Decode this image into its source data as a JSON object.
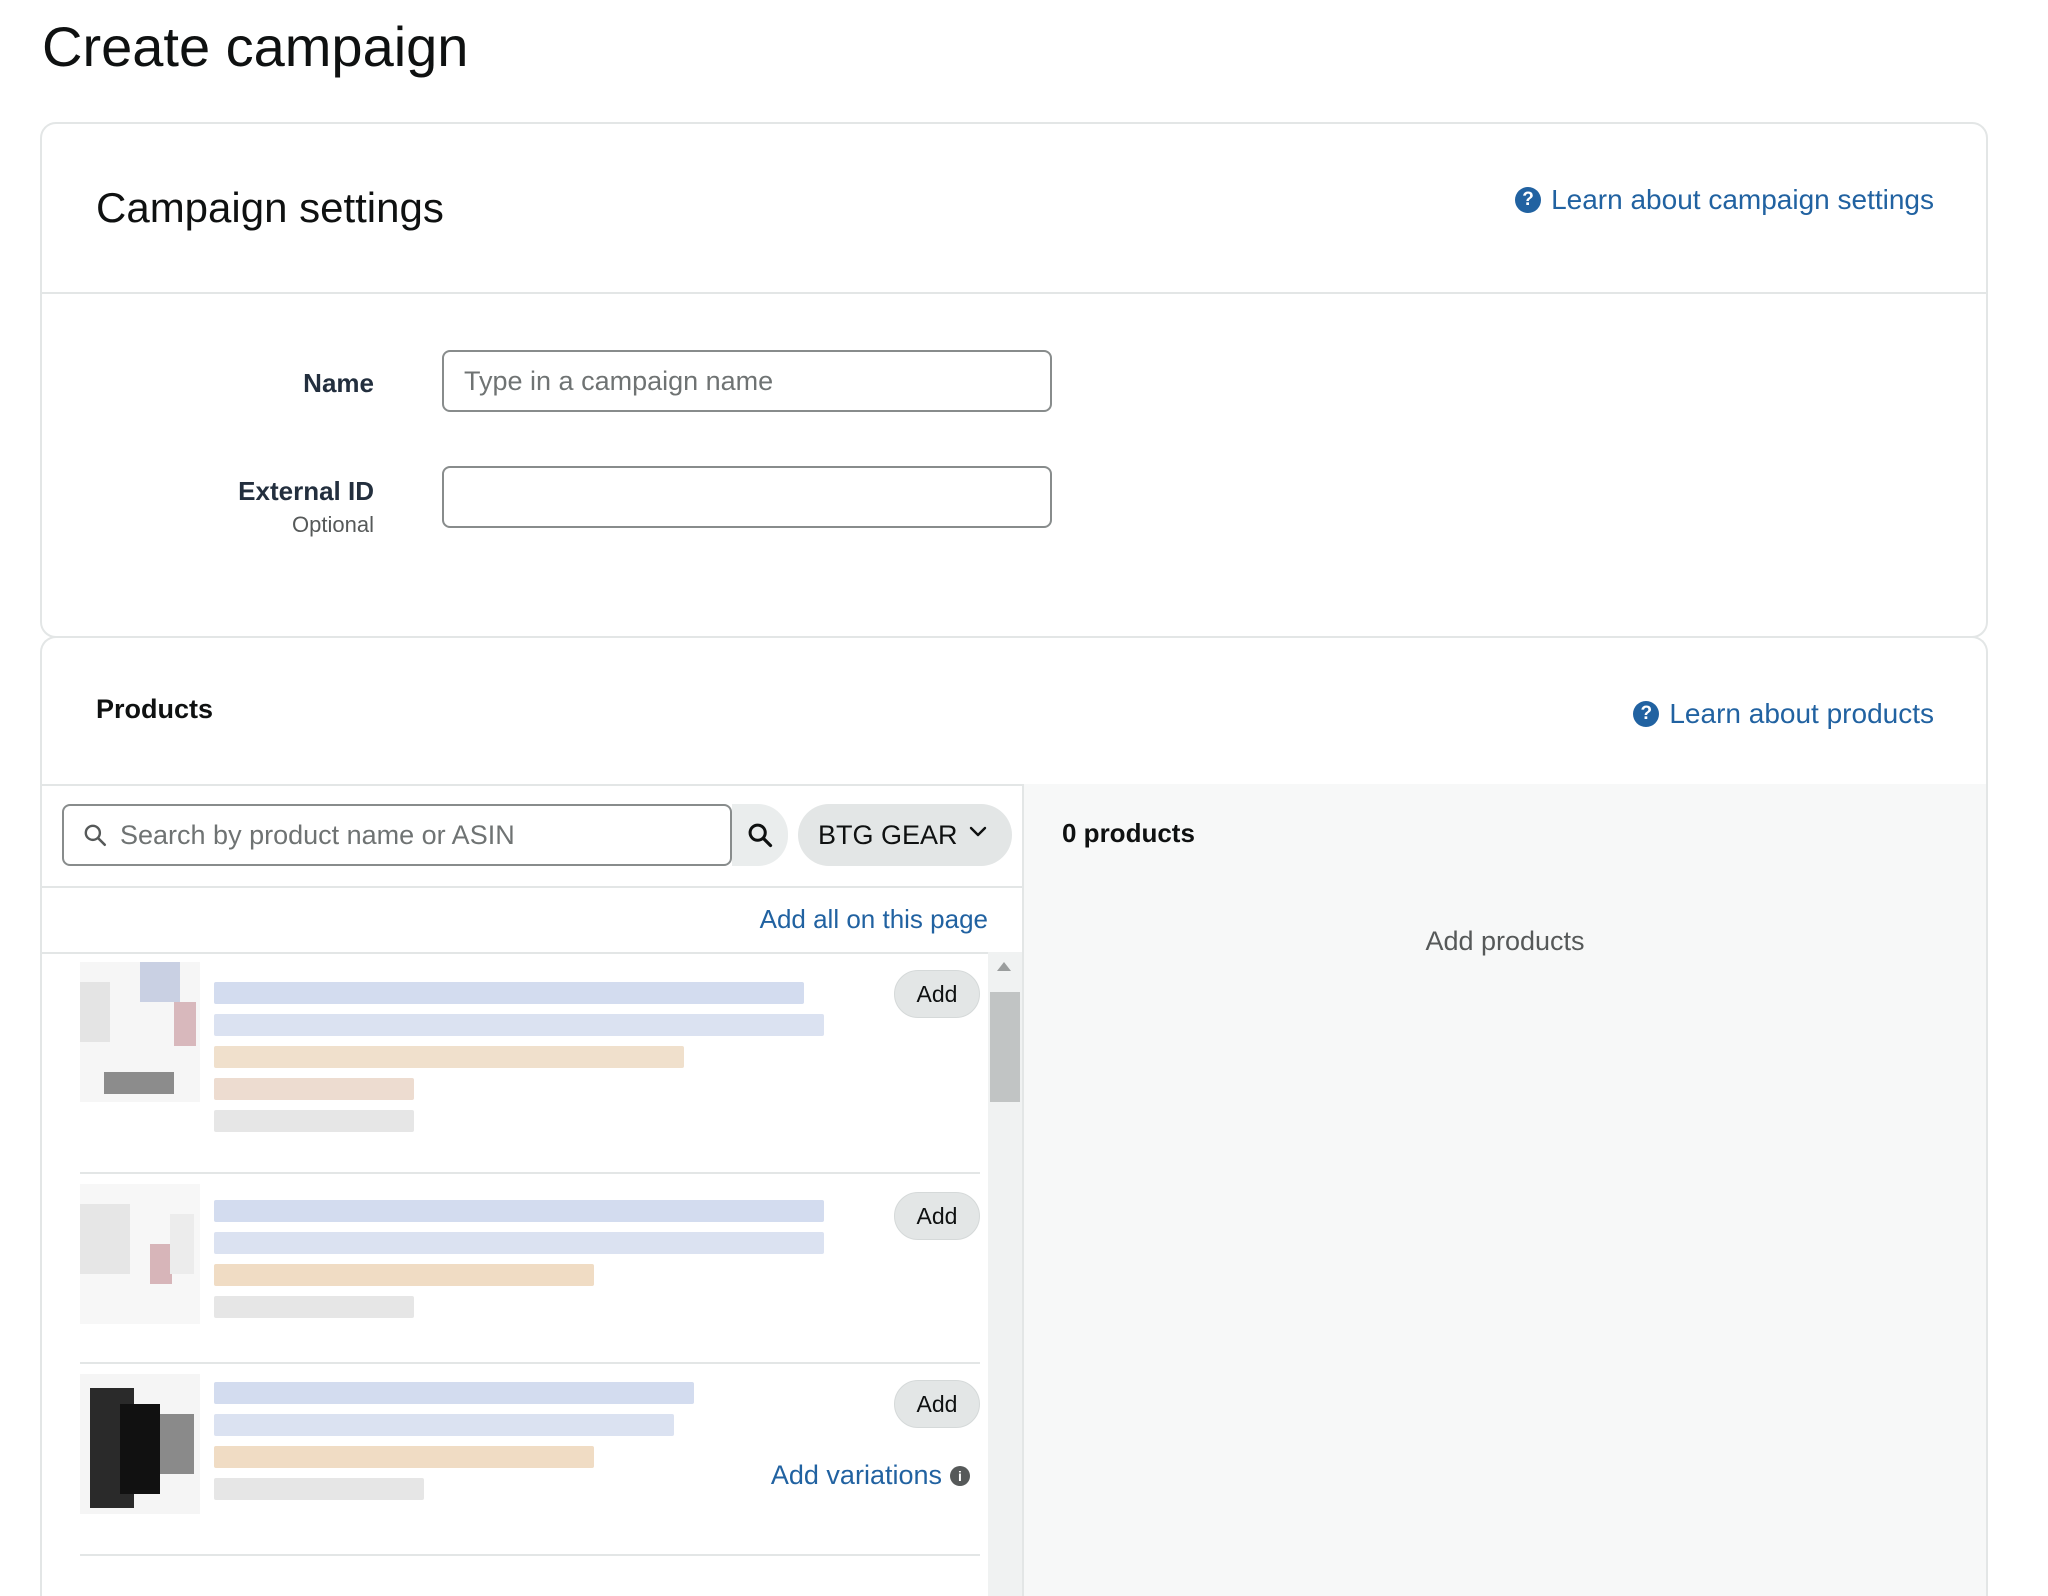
{
  "page": {
    "title": "Create campaign"
  },
  "settings": {
    "title": "Campaign settings",
    "help_link": "Learn about campaign settings",
    "name_label": "Name",
    "name_placeholder": "Type in a campaign name",
    "name_value": "",
    "external_id_label": "External ID",
    "external_id_sub": "Optional",
    "external_id_value": ""
  },
  "products": {
    "title": "Products",
    "help_link": "Learn about products",
    "search_placeholder": "Search by product name or ASIN",
    "brand_selected": "BTG GEAR",
    "add_all_label": "Add all on this page",
    "items": [
      {
        "add_label": "Add"
      },
      {
        "add_label": "Add"
      },
      {
        "add_label": "Add",
        "variations_label": "Add variations"
      }
    ],
    "selected_count_label": "0 products",
    "empty_label": "Add products"
  },
  "colors": {
    "link": "#2162a1",
    "text": "#0f1111",
    "border": "#e3e6e6",
    "button_bg": "#e3e6e6",
    "panel_bg": "#f7f8f8"
  },
  "icons": [
    "help-icon",
    "search-icon",
    "chevron-down-icon",
    "info-icon"
  ]
}
